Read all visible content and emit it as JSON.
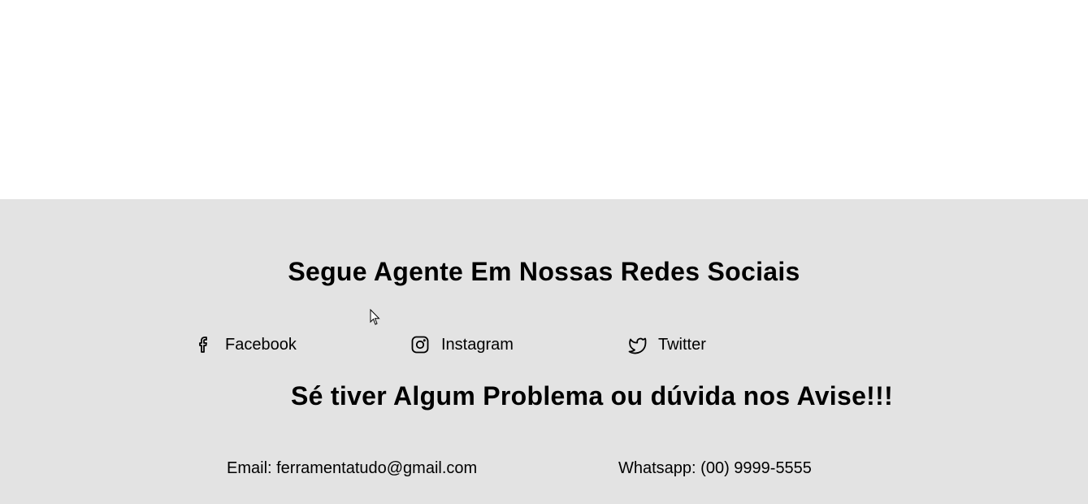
{
  "footer": {
    "social_title": "Segue Agente Em Nossas Redes Sociais",
    "social_links": [
      {
        "label": "Facebook",
        "icon": "facebook-icon"
      },
      {
        "label": "Instagram",
        "icon": "instagram-icon"
      },
      {
        "label": "Twitter",
        "icon": "twitter-icon"
      }
    ],
    "help_title": "Sé tiver Algum Problema ou dúvida nos Avise!!!",
    "email": "Email: ferramentatudo@gmail.com",
    "whatsapp": "Whatsapp: (00) 9999-5555"
  },
  "colors": {
    "page_background": "#ffffff",
    "footer_background": "#e3e3e3",
    "text": "#000000"
  }
}
